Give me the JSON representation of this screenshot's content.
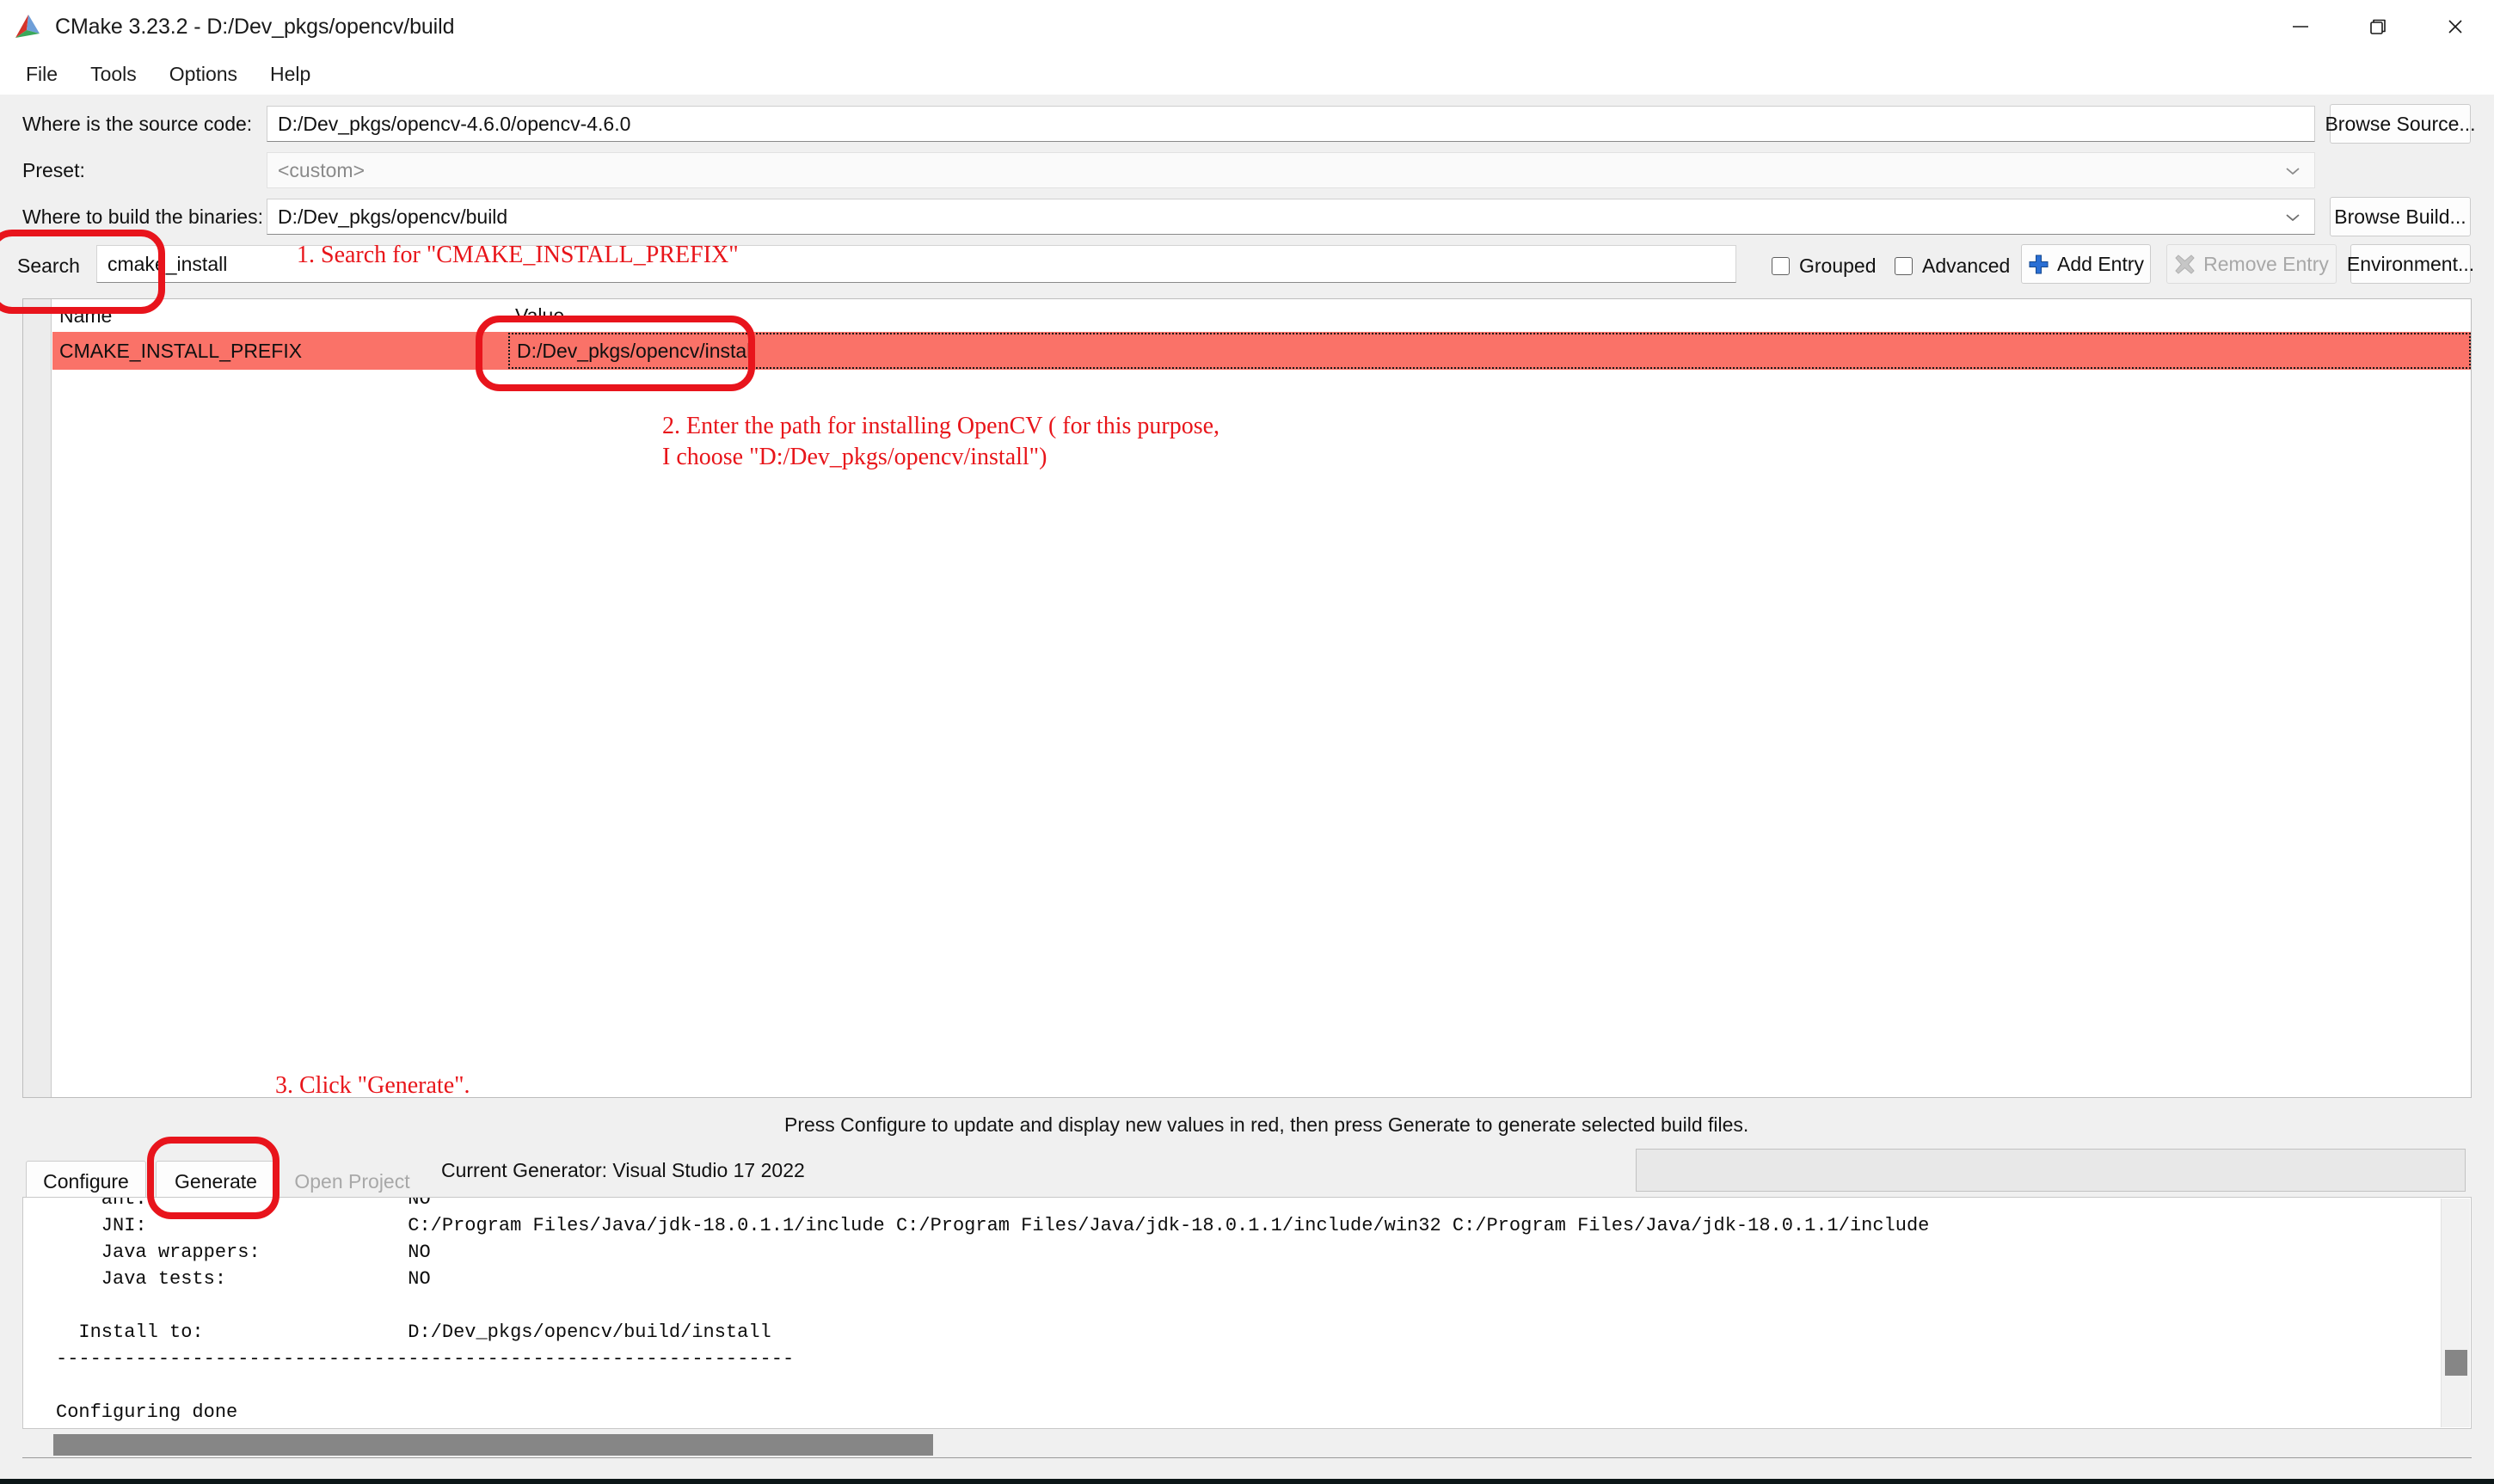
{
  "window": {
    "title": "CMake 3.23.2 - D:/Dev_pkgs/opencv/build",
    "minimize_label": "—",
    "restore_label": "❐",
    "close_label": "✕"
  },
  "menu": {
    "items": [
      {
        "label": "File"
      },
      {
        "label": "Tools"
      },
      {
        "label": "Options"
      },
      {
        "label": "Help"
      }
    ]
  },
  "form": {
    "source_label": "Where is the source code:",
    "source_value": "D:/Dev_pkgs/opencv-4.6.0/opencv-4.6.0",
    "browse_source_label": "Browse Source...",
    "preset_label": "Preset:",
    "preset_value": "<custom>",
    "build_label": "Where to build the binaries:",
    "build_value": "D:/Dev_pkgs/opencv/build",
    "browse_build_label": "Browse Build..."
  },
  "search": {
    "label": "Search",
    "value": "cmake_install",
    "placeholder": ""
  },
  "toolbar": {
    "grouped_label": "Grouped",
    "grouped_checked": false,
    "advanced_label": "Advanced",
    "advanced_checked": false,
    "add_entry_label": "Add Entry",
    "remove_entry_label": "Remove Entry",
    "environment_label": "Environment..."
  },
  "cache_table": {
    "columns": [
      "Name",
      "Value"
    ],
    "rows": [
      {
        "name": "CMAKE_INSTALL_PREFIX",
        "value": "D:/Dev_pkgs/opencv/install",
        "highlighted": true,
        "highlight_color": "#fa7268"
      }
    ]
  },
  "status": {
    "hint": "Press Configure to update and display new values in red, then press Generate to generate selected build files.",
    "generator": "Current Generator: Visual Studio 17 2022",
    "progress_percent": 0
  },
  "actions": {
    "configure_label": "Configure",
    "generate_label": "Generate",
    "open_project_label": "Open Project",
    "open_project_disabled": true
  },
  "console": {
    "lines": [
      "    ant:                       NO",
      "    JNI:                       C:/Program Files/Java/jdk-18.0.1.1/include C:/Program Files/Java/jdk-18.0.1.1/include/win32 C:/Program Files/Java/jdk-18.0.1.1/include",
      "    Java wrappers:             NO",
      "    Java tests:                NO",
      "",
      "  Install to:                  D:/Dev_pkgs/opencv/build/install",
      "-----------------------------------------------------------------",
      "",
      "Configuring done"
    ]
  },
  "annotations": {
    "step1": "1. Search for \"CMAKE_INSTALL_PREFIX\"",
    "step2": "2. Enter the path for installing OpenCV ( for this purpose,\nI choose \"D:/Dev_pkgs/opencv/install\")",
    "step3": "3. Click \"Generate\".",
    "color": "#e8151a"
  }
}
